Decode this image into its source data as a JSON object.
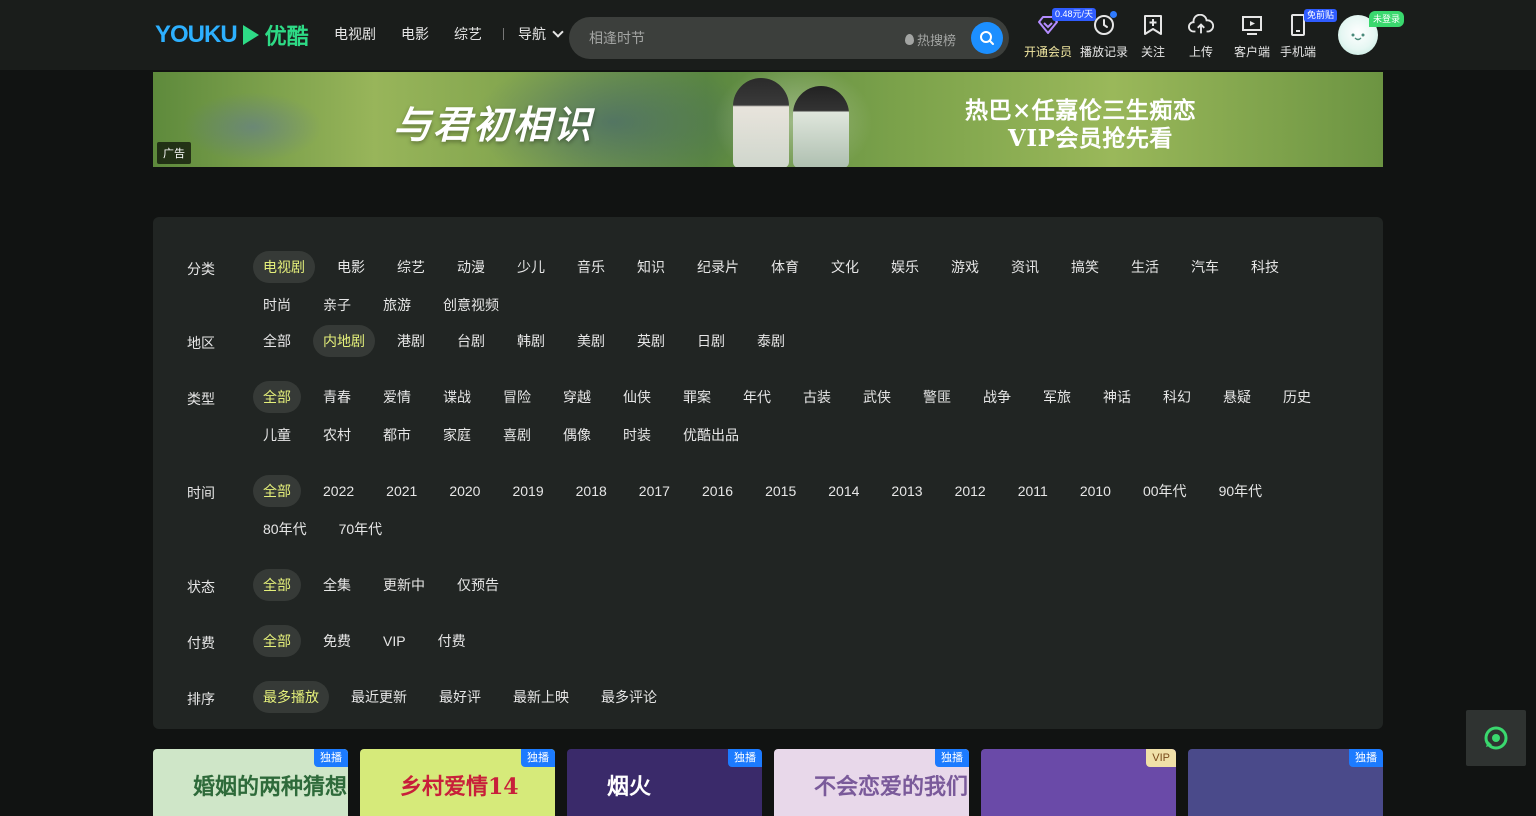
{
  "header": {
    "logo_en": "YOUKU",
    "logo_cn": "优酷",
    "nav": [
      "电视剧",
      "电影",
      "综艺"
    ],
    "nav_guide": "导航",
    "search_placeholder": "相逢时节",
    "hot_label": "热搜榜",
    "vip_price_badge": "0.48元/天",
    "tools": {
      "vip": "开通会员",
      "history": "播放记录",
      "follow": "关注",
      "upload": "上传",
      "client": "客户端",
      "mobile": "手机端"
    },
    "mobile_badge": "免前贴",
    "login_badge": "未登录"
  },
  "banner": {
    "title": "与君初相识",
    "right_line1": "热巴×任嘉伦三生痴恋",
    "right_line2": "VIP会员抢先看",
    "ad_tag": "广告"
  },
  "filters": {
    "category": {
      "label": "分类",
      "active": 0,
      "options": [
        "电视剧",
        "电影",
        "综艺",
        "动漫",
        "少儿",
        "音乐",
        "知识",
        "纪录片",
        "体育",
        "文化",
        "娱乐",
        "游戏",
        "资讯",
        "搞笑",
        "生活",
        "汽车",
        "科技",
        "时尚",
        "亲子",
        "旅游",
        "创意视频"
      ]
    },
    "region": {
      "label": "地区",
      "active": 1,
      "options": [
        "全部",
        "内地剧",
        "港剧",
        "台剧",
        "韩剧",
        "美剧",
        "英剧",
        "日剧",
        "泰剧"
      ]
    },
    "genre": {
      "label": "类型",
      "active": 0,
      "options": [
        "全部",
        "青春",
        "爱情",
        "谍战",
        "冒险",
        "穿越",
        "仙侠",
        "罪案",
        "年代",
        "古装",
        "武侠",
        "警匪",
        "战争",
        "军旅",
        "神话",
        "科幻",
        "悬疑",
        "历史",
        "儿童",
        "农村",
        "都市",
        "家庭",
        "喜剧",
        "偶像",
        "时装",
        "优酷出品"
      ]
    },
    "year": {
      "label": "时间",
      "active": 0,
      "options": [
        "全部",
        "2022",
        "2021",
        "2020",
        "2019",
        "2018",
        "2017",
        "2016",
        "2015",
        "2014",
        "2013",
        "2012",
        "2011",
        "2010",
        "00年代",
        "90年代",
        "80年代",
        "70年代"
      ]
    },
    "status": {
      "label": "状态",
      "active": 0,
      "options": [
        "全部",
        "全集",
        "更新中",
        "仅预告"
      ]
    },
    "pay": {
      "label": "付费",
      "active": 0,
      "options": [
        "全部",
        "免费",
        "VIP",
        "付费"
      ]
    },
    "sort": {
      "label": "排序",
      "active": 0,
      "options": [
        "最多播放",
        "最近更新",
        "最好评",
        "最新上映",
        "最多评论"
      ]
    }
  },
  "cards": [
    {
      "badge": "独播",
      "badge_type": "blue",
      "title": "婚姻的两种猜想",
      "bg": "#cfe6c8",
      "color": "#2e6a3a"
    },
    {
      "badge": "独播",
      "badge_type": "blue",
      "title": "乡村爱情14",
      "bg": "#d6ea7a",
      "color": "#c8203a"
    },
    {
      "badge": "独播",
      "badge_type": "blue",
      "title": "烟火",
      "bg": "#3a2a6a",
      "color": "#ffffff"
    },
    {
      "badge": "独播",
      "badge_type": "blue",
      "title": "不会恋爱的我们",
      "bg": "#e8d8ea",
      "color": "#7a5a9a"
    },
    {
      "badge": "VIP",
      "badge_type": "vip",
      "title": "",
      "bg": "#6a4aa8",
      "color": "#ffffff"
    },
    {
      "badge": "独播",
      "badge_type": "blue",
      "title": "",
      "bg": "#4a4a8a",
      "color": "#ffffff"
    }
  ],
  "colors": {
    "accent_active": "#e4ef7a",
    "search_button": "#1c8fff",
    "badge_blue": "#1c7bff"
  },
  "icons": {
    "vip": "diamond-icon",
    "history": "clock-icon",
    "follow": "bookmark-plus-icon",
    "upload": "cloud-upload-icon",
    "client": "tv-play-icon",
    "mobile": "phone-icon",
    "search": "search-icon",
    "float": "support-icon"
  }
}
